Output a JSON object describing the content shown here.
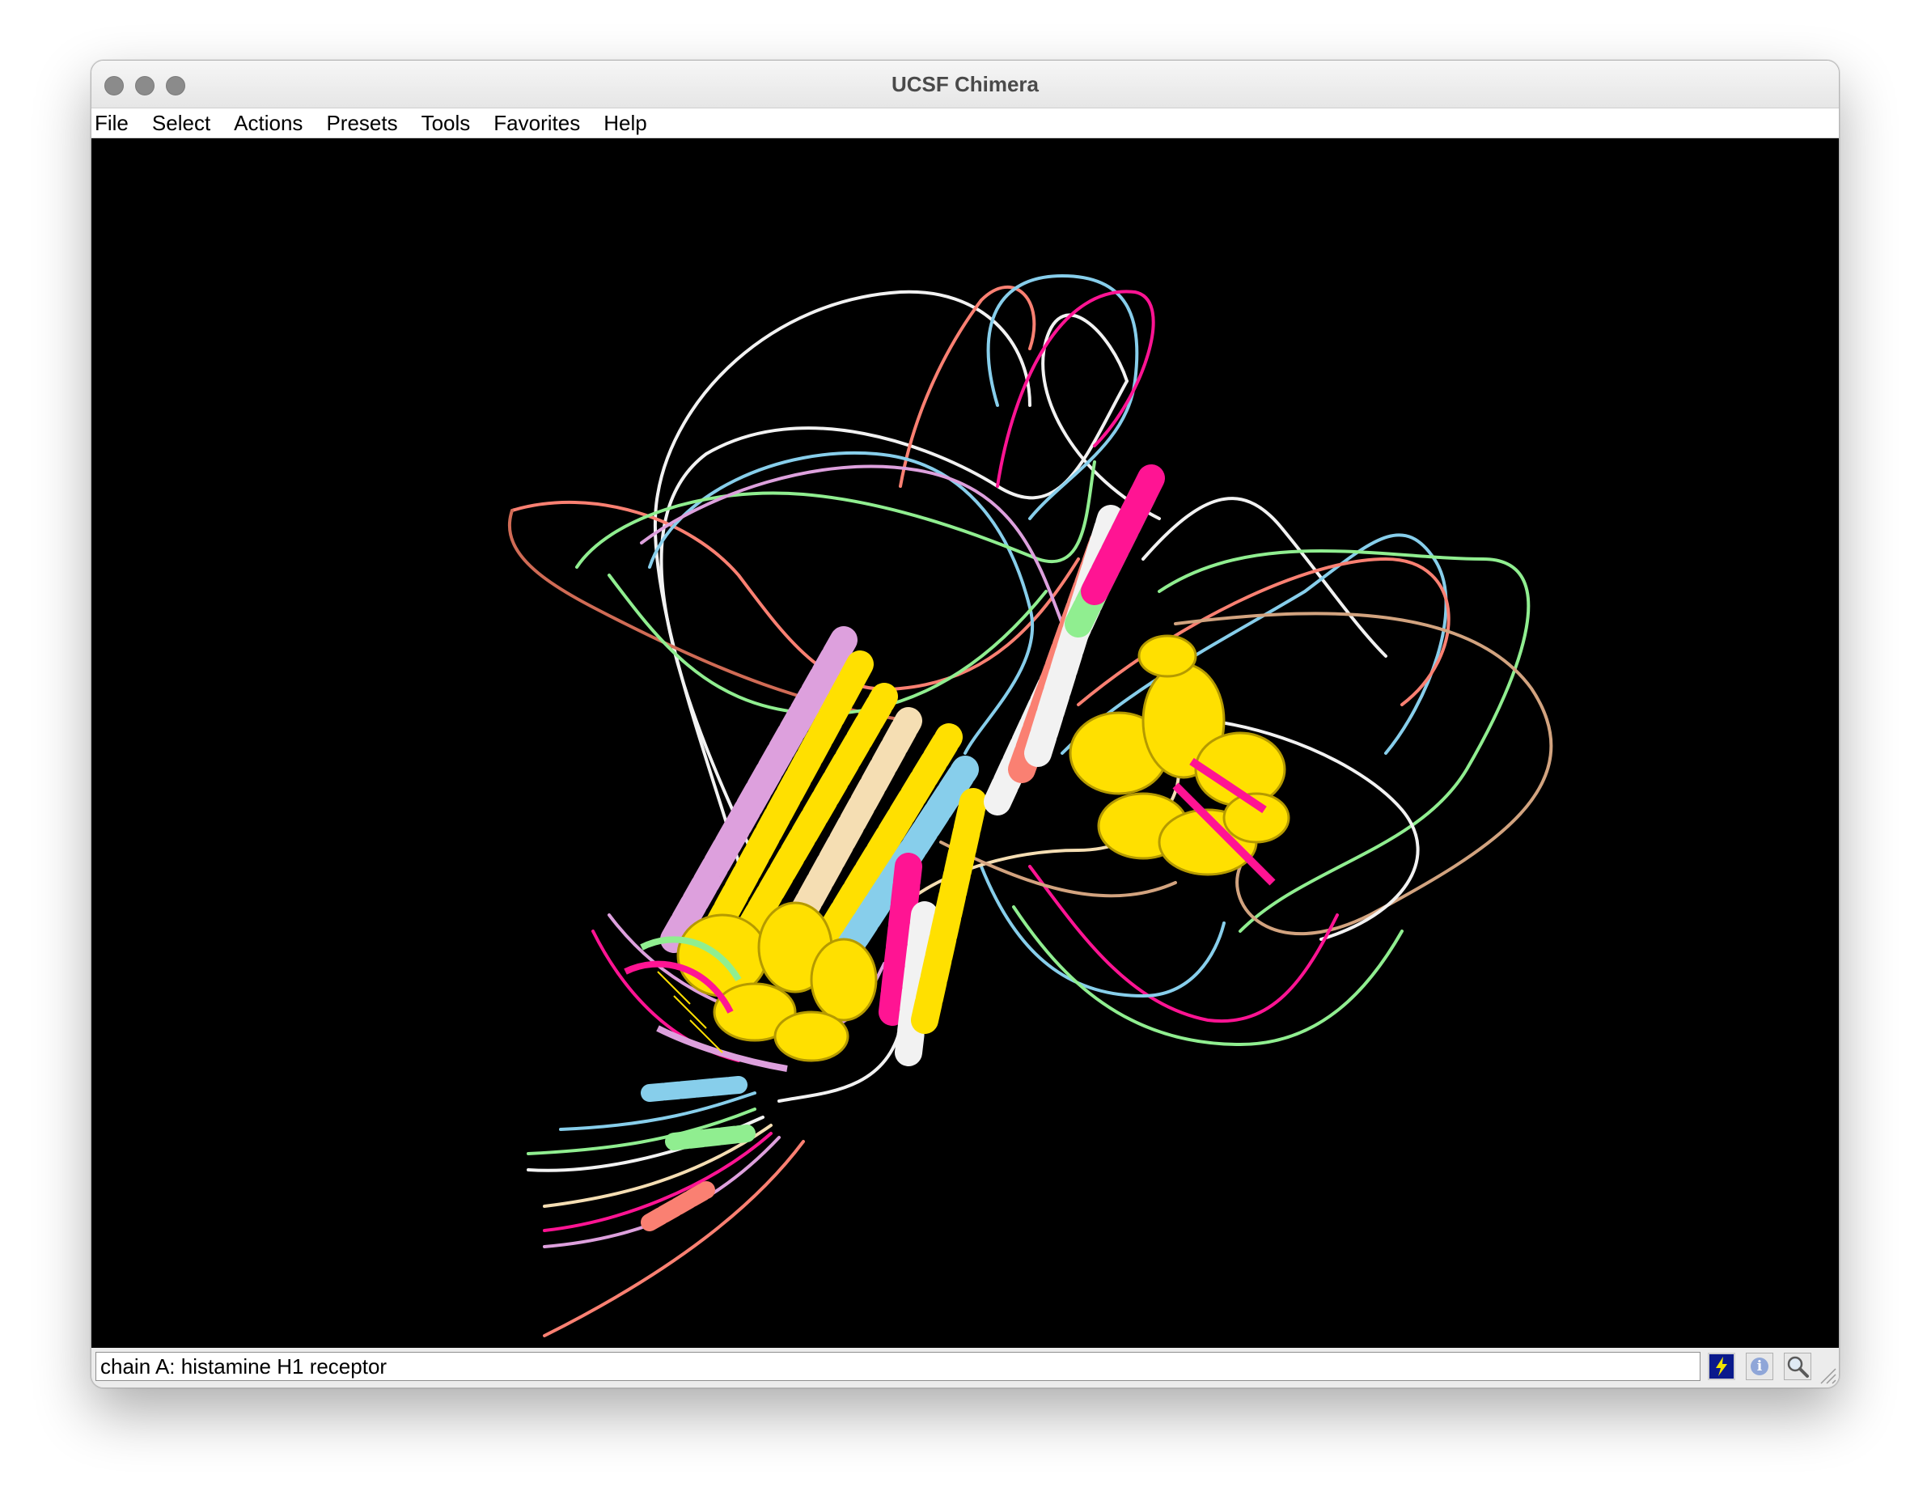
{
  "window": {
    "title": "UCSF Chimera"
  },
  "menu": {
    "items": [
      "File",
      "Select",
      "Actions",
      "Presets",
      "Tools",
      "Favorites",
      "Help"
    ]
  },
  "viewer": {
    "background": "#000000",
    "ribbon_colors": [
      "#ffe000",
      "#ff1493",
      "#f2f2f2",
      "#fa8072",
      "#87ceeb",
      "#90ee90",
      "#dda0dd",
      "#f5deb3",
      "#d2a37f"
    ]
  },
  "status": {
    "text": "chain A: histamine H1 receptor"
  },
  "status_buttons": {
    "lightning_icon": "lightning-icon",
    "info_icon": "info-icon",
    "search_icon": "magnifier-icon",
    "info_glyph": "i"
  }
}
